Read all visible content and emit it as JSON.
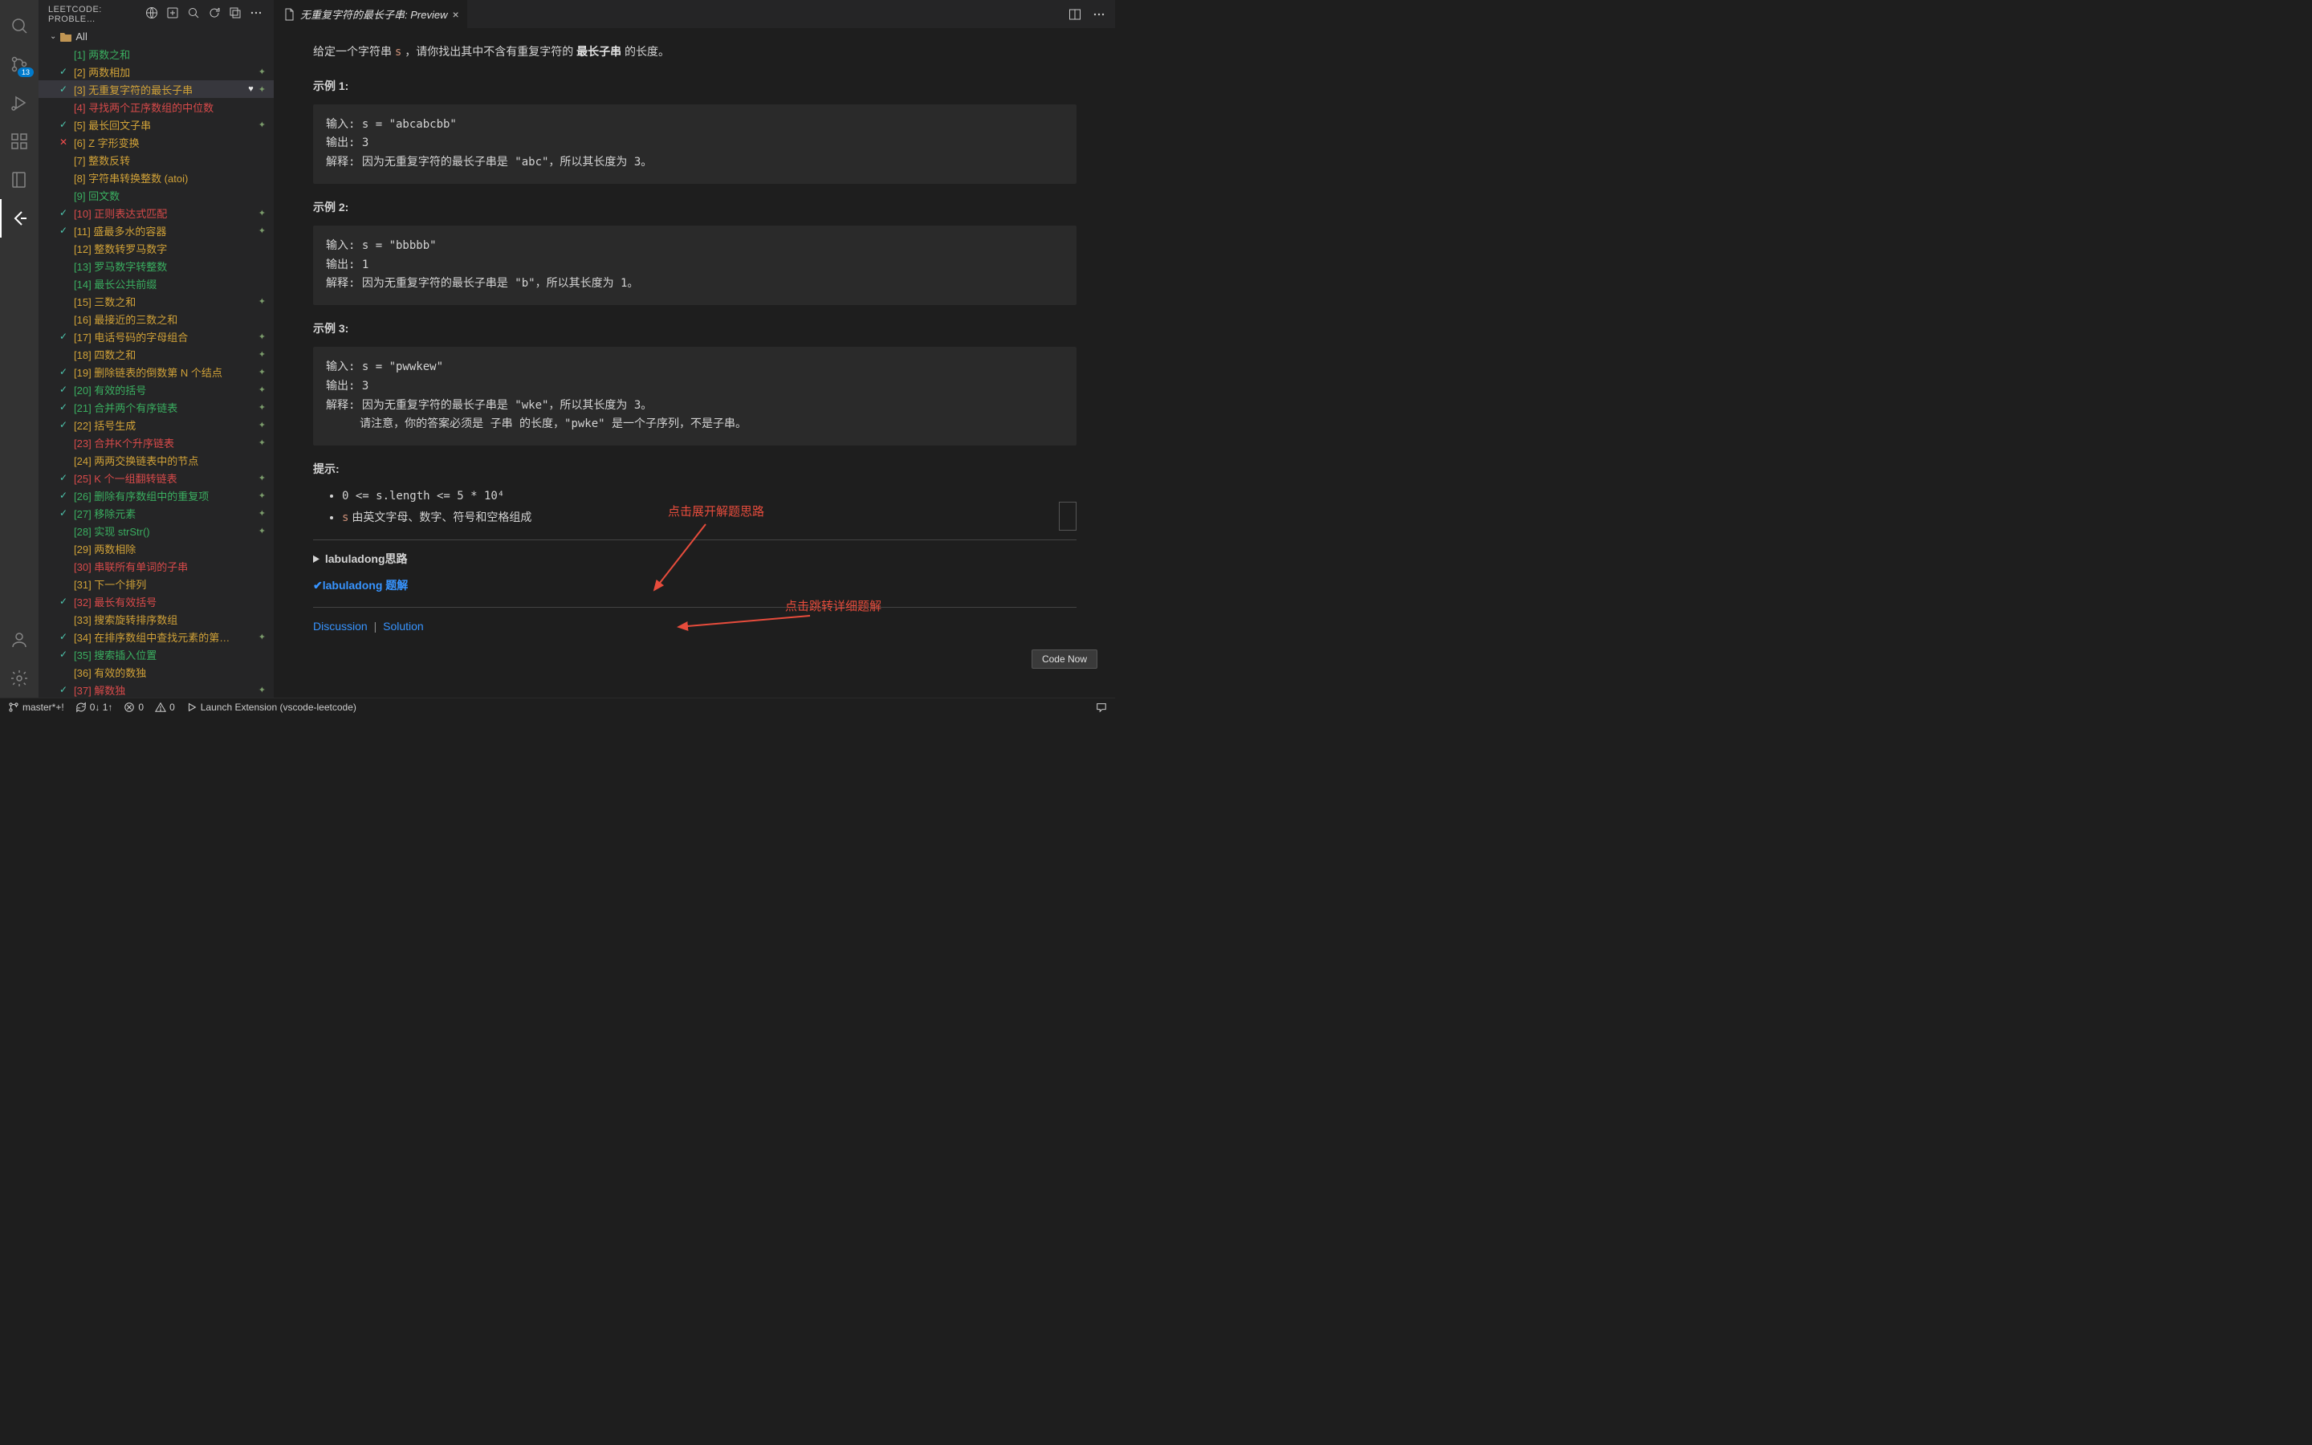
{
  "sidebar": {
    "title": "LEETCODE: PROBLE…",
    "folder": "All"
  },
  "activity": {
    "scm_badge": "13"
  },
  "tab": {
    "title": "无重复字符的最长子串: Preview"
  },
  "preview": {
    "intro_before": "给定一个字符串 ",
    "intro_var": "s",
    "intro_after": " ，请你找出其中不含有重复字符的 ",
    "intro_bold": "最长子串",
    "intro_end": " 的长度。",
    "ex1_label": "示例 1:",
    "ex1_code": "输入: s = \"abcabcbb\"\n输出: 3\n解释: 因为无重复字符的最长子串是 \"abc\"，所以其长度为 3。",
    "ex2_label": "示例 2:",
    "ex2_code": "输入: s = \"bbbbb\"\n输出: 1\n解释: 因为无重复字符的最长子串是 \"b\"，所以其长度为 1。",
    "ex3_label": "示例 3:",
    "ex3_code": "输入: s = \"pwwkew\"\n输出: 3\n解释: 因为无重复字符的最长子串是 \"wke\"，所以其长度为 3。\n     请注意，你的答案必须是 子串 的长度，\"pwke\" 是一个子序列，不是子串。",
    "hints_label": "提示:",
    "hint1": "0 <= s.length <= 5 * 10⁴",
    "hint2_var": "s",
    "hint2_text": " 由英文字母、数字、符号和空格组成",
    "details": "labuladong思路",
    "solution_link": "✔labuladong 题解",
    "discussion": "Discussion",
    "solution": "Solution",
    "annot1": "点击展开解题思路",
    "annot2": "点击跳转详细题解",
    "code_now": "Code Now"
  },
  "status": {
    "branch": "master*+!",
    "sync": "0↓ 1↑",
    "errors": "0",
    "warnings": "0",
    "launch": "Launch Extension (vscode-leetcode)"
  },
  "problems": [
    {
      "n": 1,
      "t": "两数之和",
      "d": "easy",
      "s": "",
      "sp": false
    },
    {
      "n": 2,
      "t": "两数相加",
      "d": "medium",
      "s": "done",
      "sp": true
    },
    {
      "n": 3,
      "t": "无重复字符的最长子串",
      "d": "medium",
      "s": "done",
      "sp": true,
      "sel": true,
      "heart": true
    },
    {
      "n": 4,
      "t": "寻找两个正序数组的中位数",
      "d": "hard",
      "s": "",
      "sp": false
    },
    {
      "n": 5,
      "t": "最长回文子串",
      "d": "medium",
      "s": "done",
      "sp": true
    },
    {
      "n": 6,
      "t": "Z 字形变换",
      "d": "medium",
      "s": "fail",
      "sp": false
    },
    {
      "n": 7,
      "t": "整数反转",
      "d": "medium",
      "s": "",
      "sp": false
    },
    {
      "n": 8,
      "t": "字符串转换整数 (atoi)",
      "d": "medium",
      "s": "",
      "sp": false
    },
    {
      "n": 9,
      "t": "回文数",
      "d": "easy",
      "s": "",
      "sp": false
    },
    {
      "n": 10,
      "t": "正则表达式匹配",
      "d": "hard",
      "s": "done",
      "sp": true
    },
    {
      "n": 11,
      "t": "盛最多水的容器",
      "d": "medium",
      "s": "done",
      "sp": true
    },
    {
      "n": 12,
      "t": "整数转罗马数字",
      "d": "medium",
      "s": "",
      "sp": false
    },
    {
      "n": 13,
      "t": "罗马数字转整数",
      "d": "easy",
      "s": "",
      "sp": false
    },
    {
      "n": 14,
      "t": "最长公共前缀",
      "d": "easy",
      "s": "",
      "sp": false
    },
    {
      "n": 15,
      "t": "三数之和",
      "d": "medium",
      "s": "",
      "sp": true
    },
    {
      "n": 16,
      "t": "最接近的三数之和",
      "d": "medium",
      "s": "",
      "sp": false
    },
    {
      "n": 17,
      "t": "电话号码的字母组合",
      "d": "medium",
      "s": "done",
      "sp": true
    },
    {
      "n": 18,
      "t": "四数之和",
      "d": "medium",
      "s": "",
      "sp": true
    },
    {
      "n": 19,
      "t": "删除链表的倒数第 N 个结点",
      "d": "medium",
      "s": "done",
      "sp": true
    },
    {
      "n": 20,
      "t": "有效的括号",
      "d": "easy",
      "s": "done",
      "sp": true
    },
    {
      "n": 21,
      "t": "合并两个有序链表",
      "d": "easy",
      "s": "done",
      "sp": true
    },
    {
      "n": 22,
      "t": "括号生成",
      "d": "medium",
      "s": "done",
      "sp": true
    },
    {
      "n": 23,
      "t": "合并K个升序链表",
      "d": "hard",
      "s": "",
      "sp": true
    },
    {
      "n": 24,
      "t": "两两交换链表中的节点",
      "d": "medium",
      "s": "",
      "sp": false
    },
    {
      "n": 25,
      "t": "K 个一组翻转链表",
      "d": "hard",
      "s": "done",
      "sp": true
    },
    {
      "n": 26,
      "t": "删除有序数组中的重复项",
      "d": "easy",
      "s": "done",
      "sp": true
    },
    {
      "n": 27,
      "t": "移除元素",
      "d": "easy",
      "s": "done",
      "sp": true
    },
    {
      "n": 28,
      "t": "实现 strStr()",
      "d": "easy",
      "s": "",
      "sp": true
    },
    {
      "n": 29,
      "t": "两数相除",
      "d": "medium",
      "s": "",
      "sp": false
    },
    {
      "n": 30,
      "t": "串联所有单词的子串",
      "d": "hard",
      "s": "",
      "sp": false
    },
    {
      "n": 31,
      "t": "下一个排列",
      "d": "medium",
      "s": "",
      "sp": false
    },
    {
      "n": 32,
      "t": "最长有效括号",
      "d": "hard",
      "s": "done",
      "sp": false
    },
    {
      "n": 33,
      "t": "搜索旋转排序数组",
      "d": "medium",
      "s": "",
      "sp": false
    },
    {
      "n": 34,
      "t": "在排序数组中查找元素的第…",
      "d": "medium",
      "s": "done",
      "sp": true
    },
    {
      "n": 35,
      "t": "搜索插入位置",
      "d": "easy",
      "s": "done",
      "sp": false
    },
    {
      "n": 36,
      "t": "有效的数独",
      "d": "medium",
      "s": "",
      "sp": false
    },
    {
      "n": 37,
      "t": "解数独",
      "d": "hard",
      "s": "done",
      "sp": true
    }
  ]
}
